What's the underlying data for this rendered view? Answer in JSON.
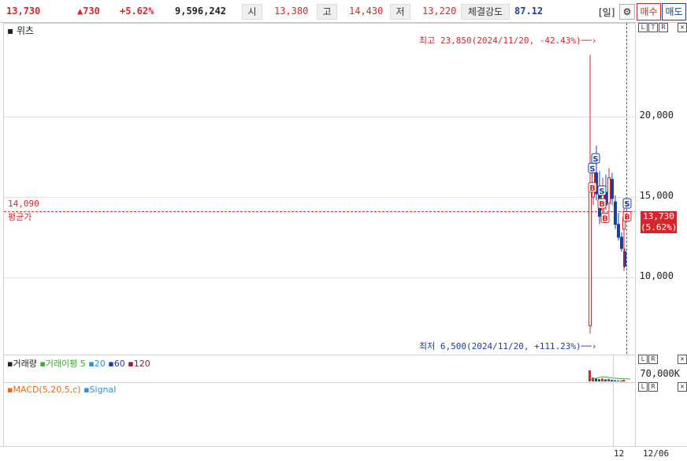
{
  "ticker": {
    "price": "13,730",
    "change": "▲730",
    "change_pct": "+5.62%",
    "volume": "9,596,242",
    "open_label": "시",
    "open": "13,380",
    "high_label": "고",
    "high": "14,430",
    "low_label": "저",
    "low": "13,220",
    "strength_label": "체결강도",
    "strength": "87.12",
    "period": "[일]",
    "settings_icon": "gear-icon",
    "buy_label": "매수",
    "sell_label": "매도"
  },
  "price_panel": {
    "title_prefix": "▪",
    "title": "위츠",
    "corner_controls": [
      "L",
      "T",
      "R"
    ],
    "close_glyph": "✕",
    "high_annotation": "최고 23,850(2024/11/20, -42.43%)",
    "low_annotation": "최저 6,500(2024/11/20, +111.23%)",
    "avg_value": "14,090",
    "avg_label": "평균가",
    "y_ticks": [
      "20,000",
      "15,000",
      "10,000"
    ],
    "current_price": "13,730",
    "current_pct": "(5.62%)",
    "signal_buy": "B",
    "signal_sell": "S"
  },
  "volume_panel": {
    "title": "거래량",
    "ma_label": "거래이평",
    "ma5": "5",
    "ma20": "20",
    "ma60": "60",
    "ma120": "120",
    "y_tick": "70,000K"
  },
  "macd_panel": {
    "title": "MACD(5,20,5,c)",
    "signal": "Signal"
  },
  "x_axis": {
    "tick": "12",
    "date": "12/06"
  },
  "colors": {
    "up": "#d7262b",
    "down": "#1b3f9c",
    "ma5": "#3aa832",
    "ma20": "#2d8fd8",
    "ma60": "#1b3f9c",
    "ma120": "#8b1a4a",
    "macd": "#e26b1a"
  },
  "chart_data": {
    "type": "candlestick",
    "y_ticks": [
      20000,
      15000,
      10000
    ],
    "high": 23850,
    "low": 6500,
    "average": 14090,
    "last": 13730,
    "candles": [
      {
        "o": 7000,
        "h": 23850,
        "l": 6500,
        "c": 15500
      },
      {
        "o": 15000,
        "h": 17000,
        "l": 14500,
        "c": 16500
      },
      {
        "o": 16500,
        "h": 18200,
        "l": 14800,
        "c": 15200
      },
      {
        "o": 15400,
        "h": 16600,
        "l": 13300,
        "c": 13800
      },
      {
        "o": 14200,
        "h": 16200,
        "l": 13800,
        "c": 15500
      },
      {
        "o": 15300,
        "h": 16400,
        "l": 14200,
        "c": 14500
      },
      {
        "o": 14600,
        "h": 16800,
        "l": 14000,
        "c": 16200
      },
      {
        "o": 16100,
        "h": 16500,
        "l": 14500,
        "c": 14900
      },
      {
        "o": 14700,
        "h": 15100,
        "l": 13000,
        "c": 13300
      },
      {
        "o": 13300,
        "h": 14000,
        "l": 12300,
        "c": 12500
      },
      {
        "o": 12500,
        "h": 12800,
        "l": 11600,
        "c": 11800
      },
      {
        "o": 11600,
        "h": 11800,
        "l": 10600,
        "c": 10700
      },
      {
        "o": 13000,
        "h": 14430,
        "l": 10400,
        "c": 13730
      }
    ],
    "volume": [
      100,
      35,
      28,
      20,
      26,
      18,
      22,
      14,
      10,
      8,
      6,
      5,
      14
    ],
    "signals": [
      {
        "i": 0,
        "t": "S",
        "v": 16800
      },
      {
        "i": 1,
        "t": "S",
        "v": 17400
      },
      {
        "i": 0,
        "t": "B",
        "v": 15600
      },
      {
        "i": 3,
        "t": "S",
        "v": 15400
      },
      {
        "i": 3,
        "t": "B",
        "v": 14600
      },
      {
        "i": 4,
        "t": "B",
        "v": 13700
      },
      {
        "i": 12,
        "t": "S",
        "v": 14600
      },
      {
        "i": 12,
        "t": "B",
        "v": 13800
      }
    ]
  }
}
